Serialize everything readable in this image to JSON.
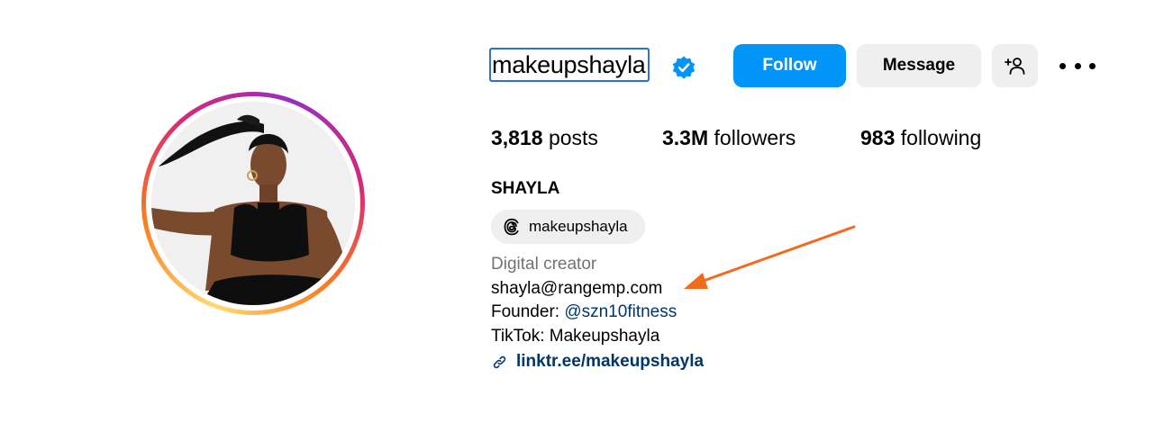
{
  "profile": {
    "username": "makeupshayla",
    "verified": true,
    "full_name": "SHAYLA",
    "category": "Digital creator",
    "bio_lines": [
      "shayla@rangemp.com",
      "TikTok: Makeupshayla"
    ],
    "founder_prefix": "Founder: ",
    "founder_mention": "@szn10fitness",
    "link": "linktr.ee/makeupshayla",
    "threads_handle": "makeupshayla"
  },
  "stats": {
    "posts_count": "3,818",
    "posts_label": " posts",
    "followers_count": "3.3M",
    "followers_label": " followers",
    "following_count": "983",
    "following_label": " following"
  },
  "actions": {
    "follow_label": "Follow",
    "message_label": "Message",
    "add_user_icon": "person-add-icon",
    "more_icon": "more-options-icon"
  },
  "colors": {
    "follow_button": "#0095f6",
    "secondary_button": "#efefef",
    "verified_badge": "#0095f6",
    "link": "#00376b",
    "annotation_arrow": "#f26a1b"
  }
}
